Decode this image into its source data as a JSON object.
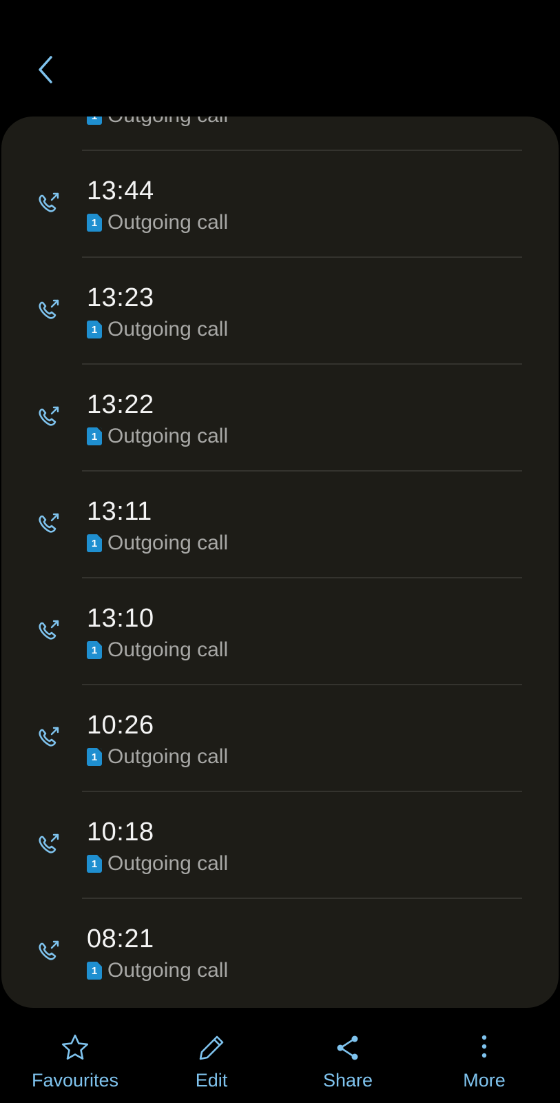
{
  "colors": {
    "background": "#000000",
    "card": "#1d1c17",
    "accent": "#7fc3ee",
    "sim_badge": "#1f8fd0",
    "time_text": "#f4f4f4",
    "secondary_text": "#a8a8a6"
  },
  "header": {
    "back_icon": "chevron-left-icon"
  },
  "partial_row": {
    "sim": "1",
    "type": "Outgoing call"
  },
  "calls": [
    {
      "time": "13:44",
      "sim": "1",
      "type": "Outgoing call",
      "icon": "outgoing-call-icon"
    },
    {
      "time": "13:23",
      "sim": "1",
      "type": "Outgoing call",
      "icon": "outgoing-call-icon"
    },
    {
      "time": "13:22",
      "sim": "1",
      "type": "Outgoing call",
      "icon": "outgoing-call-icon"
    },
    {
      "time": "13:11",
      "sim": "1",
      "type": "Outgoing call",
      "icon": "outgoing-call-icon"
    },
    {
      "time": "13:10",
      "sim": "1",
      "type": "Outgoing call",
      "icon": "outgoing-call-icon"
    },
    {
      "time": "10:26",
      "sim": "1",
      "type": "Outgoing call",
      "icon": "outgoing-call-icon"
    },
    {
      "time": "10:18",
      "sim": "1",
      "type": "Outgoing call",
      "icon": "outgoing-call-icon"
    },
    {
      "time": "08:21",
      "sim": "1",
      "type": "Outgoing call",
      "icon": "outgoing-call-icon"
    }
  ],
  "bottom_nav": {
    "favourites": {
      "label": "Favourites",
      "icon": "star-icon"
    },
    "edit": {
      "label": "Edit",
      "icon": "pencil-icon"
    },
    "share": {
      "label": "Share",
      "icon": "share-icon"
    },
    "more": {
      "label": "More",
      "icon": "more-vertical-icon"
    }
  }
}
